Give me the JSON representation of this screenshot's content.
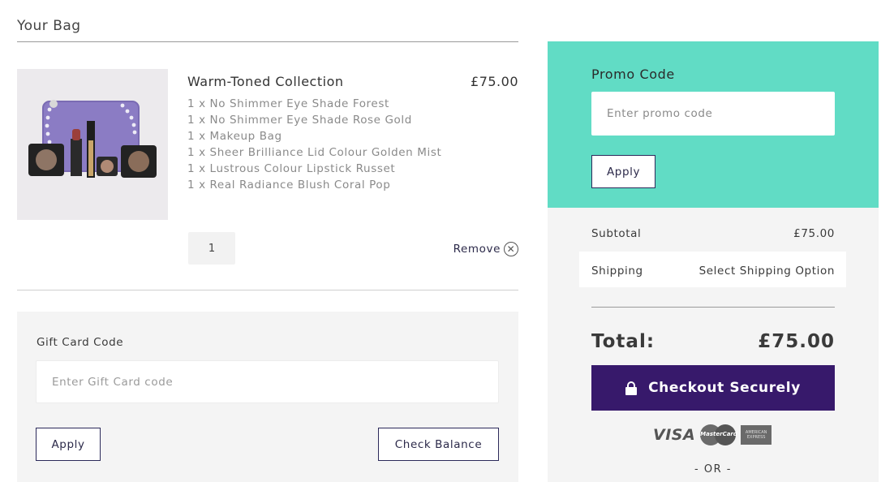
{
  "bag": {
    "title": "Your Bag",
    "item": {
      "name": "Warm-Toned Collection",
      "price": "£75.00",
      "image_alt": "makeup-bag-collection-image",
      "contents": [
        "1 x No Shimmer Eye Shade Forest",
        "1 x No Shimmer Eye Shade Rose Gold",
        "1 x Makeup Bag",
        "1 x Sheer Brilliance Lid Colour Golden Mist",
        "1 x Lustrous Colour Lipstick Russet",
        "1 x Real Radiance Blush Coral Pop"
      ],
      "quantity": "1",
      "remove_label": "Remove",
      "remove_icon": "close-circle-icon"
    }
  },
  "gift_card": {
    "label": "Gift Card Code",
    "placeholder": "Enter Gift Card code",
    "value": "",
    "apply_label": "Apply",
    "check_balance_label": "Check Balance"
  },
  "promo": {
    "title": "Promo Code",
    "placeholder": "Enter promo code",
    "value": "",
    "apply_label": "Apply"
  },
  "summary": {
    "subtotal_label": "Subtotal",
    "subtotal_value": "£75.00",
    "shipping_label": "Shipping",
    "shipping_value": "Select Shipping Option",
    "total_label": "Total:",
    "total_value": "£75.00"
  },
  "checkout": {
    "label": "Checkout Securely",
    "icon": "lock-icon"
  },
  "payment": {
    "visa_text": "VISA",
    "mastercard_text": "MasterCard",
    "amex_text": "AMERICAN EXPRESS",
    "or_text": "- OR -"
  },
  "colors": {
    "promo_bg": "#61dcc5",
    "checkout_bg": "#37196b",
    "panel_bg": "#f4f4f4",
    "button_border": "#2c2a5a"
  }
}
